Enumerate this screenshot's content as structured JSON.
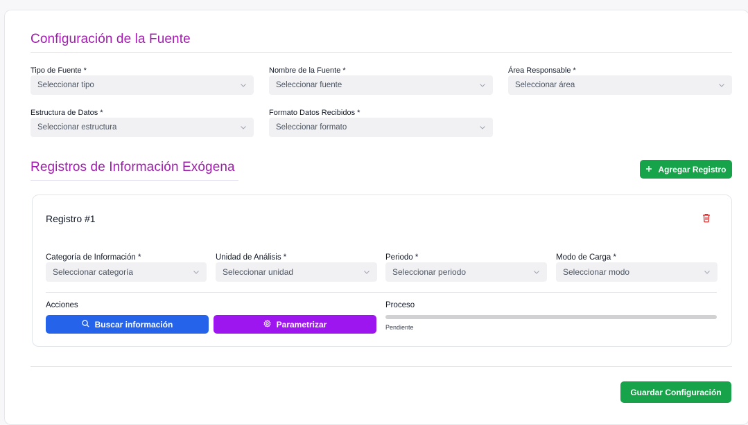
{
  "config": {
    "title": "Configuración de la Fuente",
    "fields": [
      {
        "label": "Tipo de Fuente *",
        "placeholder": "Seleccionar tipo"
      },
      {
        "label": "Nombre de la Fuente *",
        "placeholder": "Seleccionar fuente"
      },
      {
        "label": "Área Responsable *",
        "placeholder": "Seleccionar área"
      },
      {
        "label": "Estructura de Datos *",
        "placeholder": "Seleccionar estructura"
      },
      {
        "label": "Formato Datos Recibidos *",
        "placeholder": "Seleccionar formato"
      }
    ]
  },
  "registros": {
    "title": "Registros de Información Exógena",
    "add_button": "Agregar Registro",
    "items": [
      {
        "title": "Registro #1",
        "fields": [
          {
            "label": "Categoría de Información *",
            "placeholder": "Seleccionar categoría"
          },
          {
            "label": "Unidad de Análisis *",
            "placeholder": "Seleccionar unidad"
          },
          {
            "label": "Periodo *",
            "placeholder": "Seleccionar periodo"
          },
          {
            "label": "Modo de Carga *",
            "placeholder": "Seleccionar modo"
          }
        ],
        "acciones_label": "Acciones",
        "buscar_button": "Buscar información",
        "parametrizar_button": "Parametrizar",
        "proceso_label": "Proceso",
        "proceso_status": "Pendiente",
        "proceso_progress": 0
      }
    ]
  },
  "footer": {
    "save_button": "Guardar Configuración"
  },
  "colors": {
    "accent_title": "#a21caf",
    "green": "#16a34a",
    "blue": "#2563eb",
    "purple": "#9d16f0",
    "delete": "#dc2626"
  },
  "icons": {
    "select": "chevron-down-icon",
    "add": "plus-icon",
    "delete": "trash-icon",
    "search": "search-icon",
    "settings": "gear-icon"
  }
}
